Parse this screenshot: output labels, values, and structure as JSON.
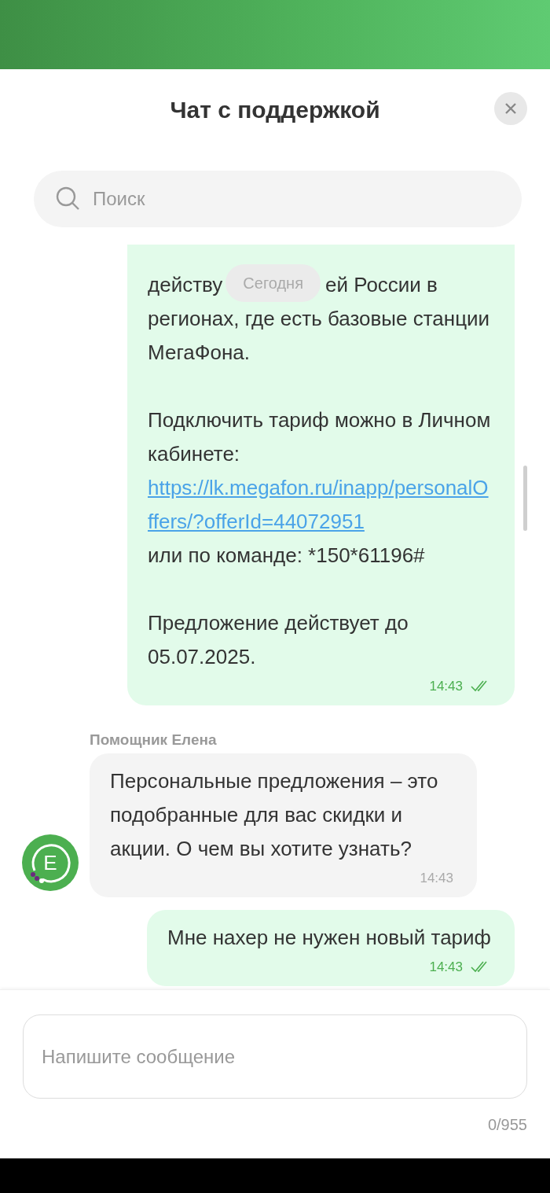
{
  "header": {
    "title": "Чат с поддержкой"
  },
  "search": {
    "placeholder": "Поиск"
  },
  "date_chip": "Сегодня",
  "messages": [
    {
      "kind": "outgoing",
      "paragraphs": [
        {
          "covered_start": "действу",
          "covered_end": "ей России в",
          "text": "регионах, где есть базовые станции МегаФона."
        },
        {
          "text": "Подключить тариф можно в Личном кабинете:",
          "link": "https://lk.megafon.ru/inapp/personalOffers/?offerId=44072951",
          "after": "или по команде: *150*61196#"
        },
        {
          "text": "Предложение действует до 05.07.2025."
        }
      ],
      "time": "14:43",
      "read": true
    },
    {
      "kind": "incoming",
      "sender": "Помощник Елена",
      "avatar_letter": "Е",
      "paragraphs": [
        {
          "text": "Персональные предложения – это подобранные для вас скидки и акции. О чем вы хотите узнать?"
        }
      ],
      "time": "14:43"
    },
    {
      "kind": "outgoing",
      "paragraphs": [
        {
          "text": "Мне нахер не нужен новый тариф"
        }
      ],
      "time": "14:43",
      "read": true
    }
  ],
  "composer": {
    "placeholder": "Напишите сообщение",
    "counter": "0/955"
  }
}
